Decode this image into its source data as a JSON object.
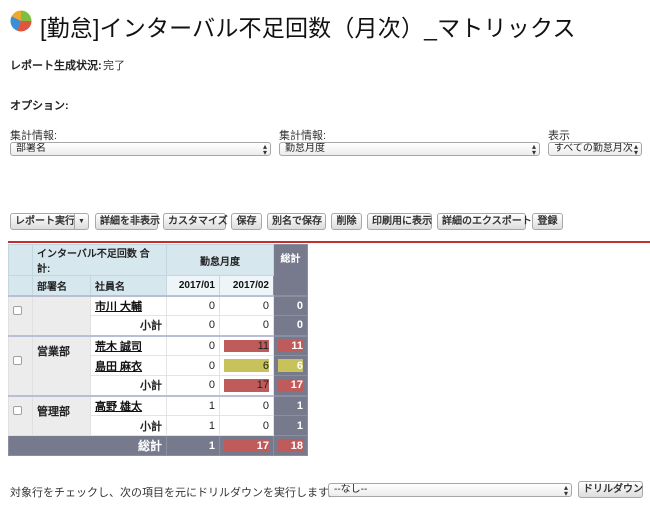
{
  "title": "[勤怠]インターバル不足回数（月次）_マトリックス",
  "status": {
    "label": "レポート生成状況:",
    "value": "完了"
  },
  "options_label": "オプション:",
  "filters": [
    {
      "label": "集計情報:",
      "value": "部署名"
    },
    {
      "label": "集計情報:",
      "value": "勤怠月度"
    },
    {
      "label": "表示",
      "value": "すべての勤怠月次"
    }
  ],
  "toolbar": {
    "run": "レポート実行",
    "hide_details": "詳細を非表示",
    "customize": "カスタマイズ",
    "save": "保存",
    "save_as": "別名で保存",
    "delete": "削除",
    "print": "印刷用に表示",
    "export": "詳細のエクスポート",
    "register": "登録"
  },
  "matrix": {
    "corner_label": "インターバル不足回数 合計:",
    "col_group_label": "勤怠月度",
    "grand_total_label": "総計",
    "row_header_dept": "部署名",
    "row_header_emp": "社員名",
    "months": [
      "2017/01",
      "2017/02"
    ],
    "subtotal_label": "小計",
    "groups": [
      {
        "dept": "",
        "rows": [
          {
            "name": "市川 大輔",
            "values": [
              0,
              0
            ],
            "total": 0
          }
        ],
        "subtotal": {
          "values": [
            0,
            0
          ],
          "total": 0
        }
      },
      {
        "dept": "営業部",
        "rows": [
          {
            "name": "荒木 誠司",
            "values": [
              0,
              11
            ],
            "total": 11
          },
          {
            "name": "島田 麻衣",
            "values": [
              0,
              6
            ],
            "total": 6
          }
        ],
        "subtotal": {
          "values": [
            0,
            17
          ],
          "total": 17
        }
      },
      {
        "dept": "管理部",
        "rows": [
          {
            "name": "高野 雄太",
            "values": [
              1,
              0
            ],
            "total": 1
          }
        ],
        "subtotal": {
          "values": [
            1,
            0
          ],
          "total": 1
        }
      }
    ],
    "grand_total": {
      "values": [
        1,
        17
      ],
      "total": 18
    }
  },
  "highlight_colors": {
    "red": "#c05b5b",
    "yellow": "#c7c25a",
    "grand_total_bg": "#767a8c",
    "header_bg": "#d6e7ee",
    "divider": "#c2302d"
  },
  "drilldown": {
    "text": "対象行をチェックし、次の項目を元にドリルダウンを実行します。",
    "select_value": "--なし--",
    "button": "ドリルダウン"
  }
}
